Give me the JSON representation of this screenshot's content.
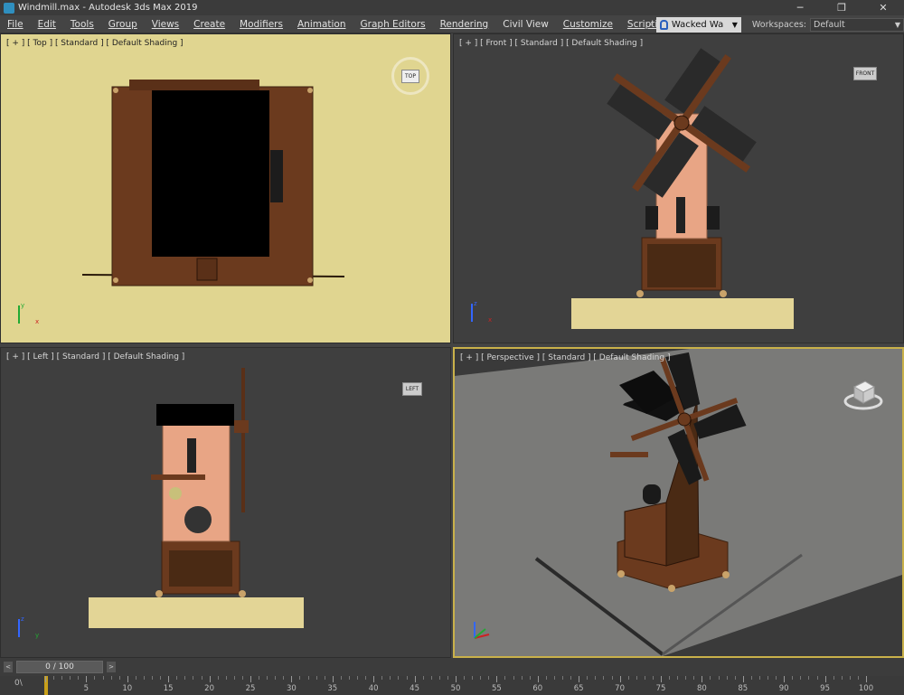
{
  "window": {
    "title": "Windmill.max - Autodesk 3ds Max 2019",
    "minimize_glyph": "─",
    "maximize_glyph": "❐",
    "close_glyph": "✕"
  },
  "menu": {
    "items": [
      "File",
      "Edit",
      "Tools",
      "Group",
      "Views",
      "Create",
      "Modifiers",
      "Animation",
      "Graph Editors",
      "Rendering",
      "Civil View",
      "Customize",
      "Scripting"
    ],
    "expand_glyph": "»",
    "user": "Wacked Wa",
    "workspaces_label": "Workspaces:",
    "workspace_value": "Default"
  },
  "viewports": {
    "top": {
      "label": "[ + ] [ Top ] [ Standard ] [ Default Shading ]",
      "cube": "TOP",
      "bg": "#e0d590"
    },
    "front": {
      "label": "[ + ] [ Front ] [ Standard ] [ Default Shading ]",
      "cube": "FRONT",
      "bg": "#3f3f3f"
    },
    "left": {
      "label": "[ + ] [ Left ] [ Standard ] [ Default Shading ]",
      "cube": "LEFT",
      "bg": "#3f3f3f"
    },
    "perspective": {
      "label": "[ + ] [ Perspective ] [ Standard ] [ Default Shading ]",
      "bg": "#3a3a3a"
    }
  },
  "axes": {
    "x": "x",
    "y": "y",
    "z": "z"
  },
  "timeline": {
    "slider_text": "0 / 100",
    "prev_glyph": "<",
    "next_glyph": ">",
    "track_start": "0\\",
    "ticks": [
      "5",
      "10",
      "15",
      "20",
      "25",
      "30",
      "35",
      "40",
      "45",
      "50",
      "55",
      "60",
      "65",
      "70",
      "75",
      "80",
      "85",
      "90",
      "95",
      "100"
    ]
  },
  "colors": {
    "wood": "#6b3a1e",
    "wood_dark": "#3d2210",
    "panel": "#e8a585",
    "base": "#e3d596",
    "sail": "#2a2a2a",
    "selection_border": "#c9b14a"
  }
}
